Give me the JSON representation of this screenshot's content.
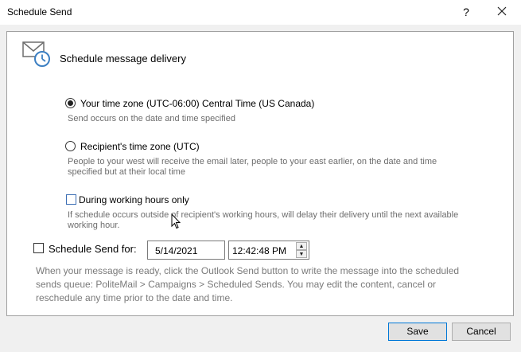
{
  "window": {
    "title": "Schedule Send",
    "help": "?"
  },
  "header": {
    "title": "Schedule message delivery"
  },
  "options": {
    "your_tz": {
      "label": "Your time zone (UTC-06:00) Central Time (US  Canada)",
      "description": "Send occurs on the date and time specified",
      "selected": true
    },
    "recipient_tz": {
      "label": "Recipient's time zone (UTC)",
      "description_line1": "People to your west will receive the email later, people to your east earlier, on the date and time",
      "description_line2": "specified but at their local time",
      "selected": false
    },
    "working_hours": {
      "label": "During working hours only",
      "description_line1": "If schedule occurs outside of recipient's working hours, will delay their delivery until the next available",
      "description_line2": "working hour.",
      "checked": false
    }
  },
  "schedule": {
    "label": "Schedule Send for:",
    "checked": false,
    "date": "5/14/2021",
    "time": "12:42:48 PM",
    "description_line1": "When your message is ready, click the Outlook Send button to write the message into the scheduled",
    "description_line2": "sends queue: PoliteMail > Campaigns > Scheduled Sends. You may edit the content, cancel or",
    "description_line3": "reschedule any time prior to the date and time."
  },
  "buttons": {
    "save": "Save",
    "cancel": "Cancel"
  },
  "icons": {
    "header": "mail-clock-icon",
    "close": "close-icon",
    "spin_up": "spin-up-icon",
    "spin_down": "spin-down-icon"
  },
  "colors": {
    "accent": "#3c7fc2",
    "checkbox_border": "#3c6eb4",
    "description_text": "#6d6d6d"
  }
}
